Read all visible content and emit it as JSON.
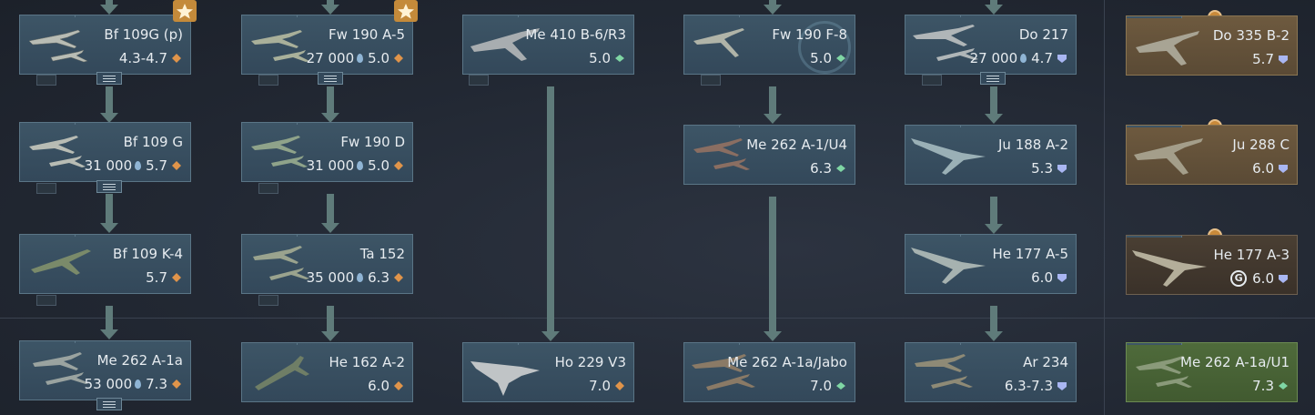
{
  "colors": {
    "rank_orange": "#e0944a",
    "rank_green": "#7fd6a4",
    "rank_blue": "#a9b6f2",
    "connector": "#5f7b7a",
    "star_gold": "#c48a3a"
  },
  "columns": [
    {
      "cards": [
        {
          "name": "Bf 109G (p)",
          "rp": "",
          "br": "4.3-4.7",
          "br_icon": "orange",
          "premium": "",
          "badge": "star",
          "folder": true
        },
        {
          "name": "Bf 109 G",
          "rp": "31 000",
          "br": "5.7",
          "br_icon": "orange",
          "premium": "",
          "folder": true
        },
        {
          "name": "Bf 109 K-4",
          "rp": "",
          "br": "5.7",
          "br_icon": "orange",
          "premium": ""
        },
        {
          "name": "Me 262 A-1a",
          "rp": "53 000",
          "br": "7.3",
          "br_icon": "orange",
          "premium": "",
          "folder": true
        }
      ]
    },
    {
      "cards": [
        {
          "name": "Fw 190 A-5",
          "rp": "27 000",
          "br": "5.0",
          "br_icon": "orange",
          "premium": "",
          "badge": "star",
          "folder": true
        },
        {
          "name": "Fw 190 D",
          "rp": "31 000",
          "br": "5.0",
          "br_icon": "orange",
          "premium": ""
        },
        {
          "name": "Ta 152",
          "rp": "35 000",
          "br": "6.3",
          "br_icon": "orange",
          "premium": ""
        },
        {
          "name": "He 162 A-2",
          "rp": "",
          "br": "6.0",
          "br_icon": "orange",
          "premium": ""
        }
      ]
    },
    {
      "cards": [
        {
          "name": "Me 410 B-6/R3",
          "rp": "",
          "br": "5.0",
          "br_icon": "green",
          "premium": ""
        },
        {
          "name": "Ho 229 V3",
          "rp": "",
          "br": "7.0",
          "br_icon": "orange",
          "premium": ""
        }
      ]
    },
    {
      "cards": [
        {
          "name": "Fw 190 F-8",
          "rp": "",
          "br": "5.0",
          "br_icon": "green",
          "premium": ""
        },
        {
          "name": "Me 262 A-1/U4",
          "rp": "",
          "br": "6.3",
          "br_icon": "green",
          "premium": ""
        },
        {
          "name": "Me 262 A-1a/Jabo",
          "rp": "",
          "br": "7.0",
          "br_icon": "green",
          "premium": ""
        }
      ]
    },
    {
      "cards": [
        {
          "name": "Do 217",
          "rp": "27 000",
          "br": "4.7",
          "br_icon": "blue",
          "premium": "",
          "folder": true
        },
        {
          "name": "Ju 188 A-2",
          "rp": "",
          "br": "5.3",
          "br_icon": "blue",
          "premium": ""
        },
        {
          "name": "He 177 A-5",
          "rp": "",
          "br": "6.0",
          "br_icon": "blue",
          "premium": ""
        },
        {
          "name": "Ar 234",
          "rp": "",
          "br": "6.3-7.3",
          "br_icon": "blue",
          "premium": ""
        }
      ]
    },
    {
      "cards": [
        {
          "name": "Do 335 B-2",
          "rp": "",
          "br": "5.7",
          "br_icon": "blue",
          "premium": "orange"
        },
        {
          "name": "Ju 288 C",
          "rp": "",
          "br": "6.0",
          "br_icon": "blue",
          "premium": "orange"
        },
        {
          "name": "He 177 A-3",
          "rp": "",
          "br": "6.0",
          "br_icon": "blue",
          "premium": "dark",
          "gift": true
        },
        {
          "name": "Me 262 A-1a/U1",
          "rp": "",
          "br": "7.3",
          "br_icon": "green",
          "premium": "green"
        }
      ]
    }
  ]
}
